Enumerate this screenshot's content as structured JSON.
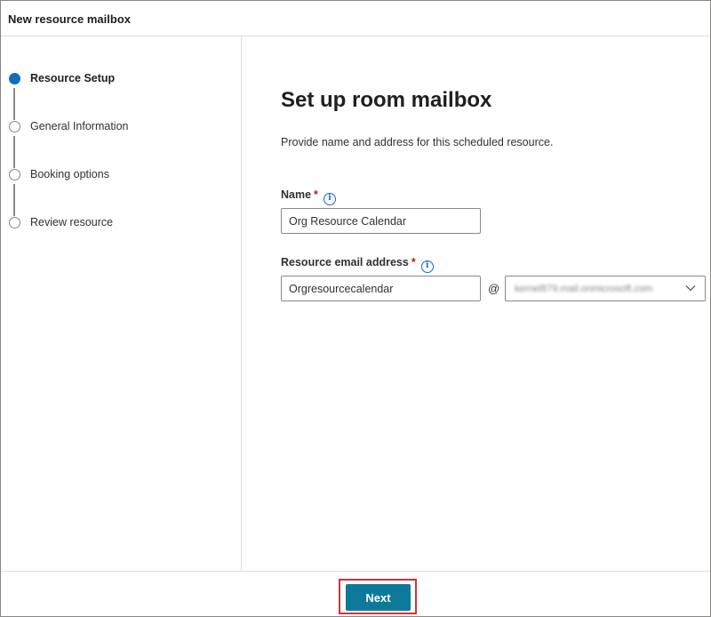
{
  "header": {
    "title": "New resource mailbox"
  },
  "sidebar": {
    "steps": [
      {
        "label": "Resource Setup",
        "active": true
      },
      {
        "label": "General Information",
        "active": false
      },
      {
        "label": "Booking options",
        "active": false
      },
      {
        "label": "Review resource",
        "active": false
      }
    ]
  },
  "main": {
    "title": "Set up room mailbox",
    "description": "Provide name and address for this scheduled resource.",
    "name_field": {
      "label": "Name",
      "required_mark": "*",
      "value": "Org Resource Calendar"
    },
    "email_field": {
      "label": "Resource email address",
      "required_mark": "*",
      "value": "Orgresourcecalendar",
      "at": "@",
      "domain_value": "kernel879.mail.onmicrosoft.com"
    },
    "info_glyph": "i"
  },
  "footer": {
    "next_label": "Next"
  },
  "colors": {
    "accent": "#0f6cbd",
    "next_button": "#0e7a9b",
    "required": "#a4262c",
    "highlight": "#d13438"
  },
  "icons": [
    "info-icon",
    "chevron-down-icon",
    "step-dot-icon"
  ]
}
